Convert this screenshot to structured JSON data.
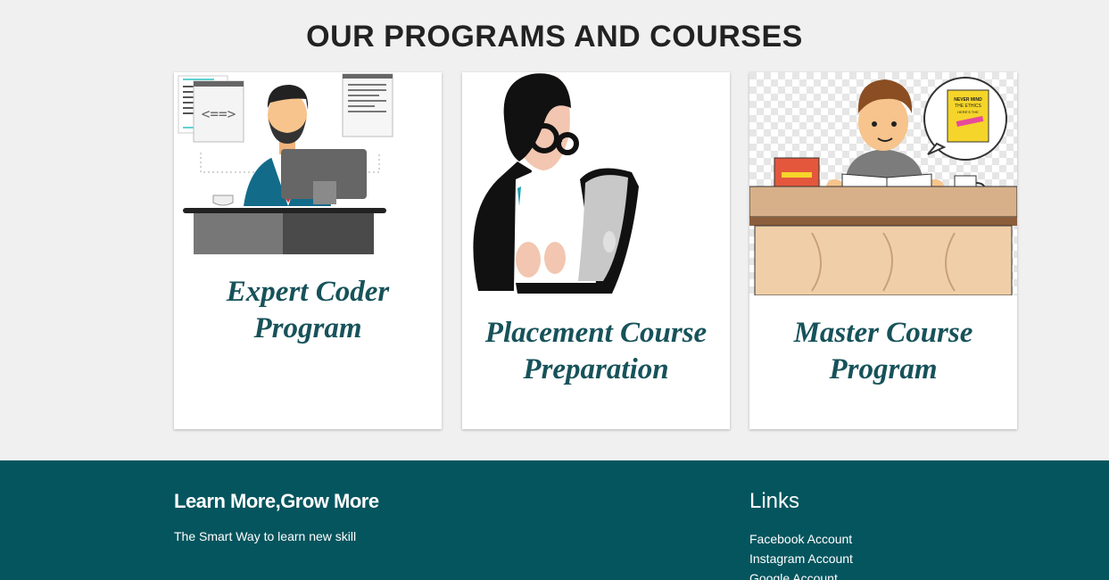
{
  "section": {
    "title": "OUR PROGRAMS AND COURSES"
  },
  "cards": [
    {
      "title_line1": "Expert Coder",
      "title_line2": "Program"
    },
    {
      "title_line1": "Placement Course",
      "title_line2": "Preparation"
    },
    {
      "title_line1": "Master Course",
      "title_line2": "Program"
    }
  ],
  "illustration_3": {
    "book_label_1": "NEVER MIND",
    "book_label_2": "THE ETHICS",
    "book_label_3": "HERE'S THE"
  },
  "footer": {
    "brand": "Learn More,Grow More",
    "tagline": "The Smart Way to learn new skill",
    "links_title": "Links",
    "links": [
      "Facebook Account",
      "Instagram Account",
      "Google Account"
    ]
  },
  "colors": {
    "teal": "#05555e",
    "title_teal": "#17525a",
    "background": "#f0f0f0"
  }
}
